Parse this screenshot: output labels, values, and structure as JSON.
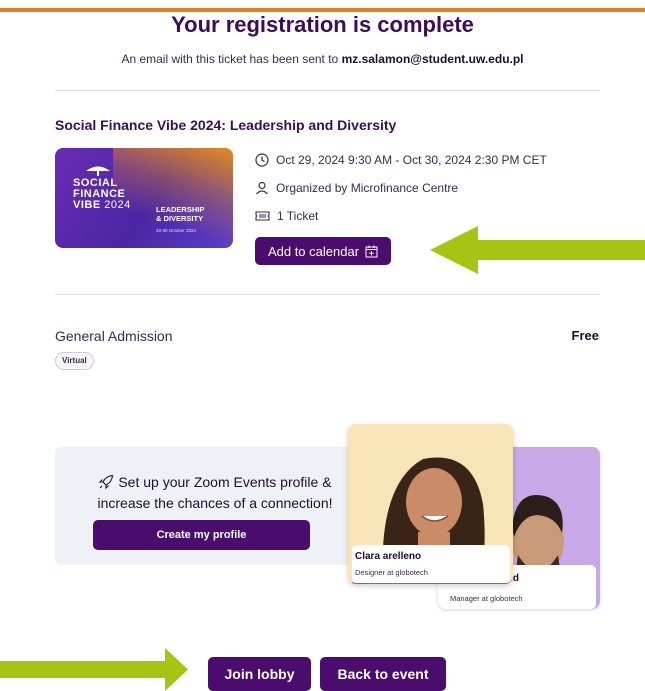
{
  "header": {
    "title": "Your registration is complete",
    "email_prefix": "An email with this ticket has been sent to",
    "email": "mz.salamon@student.uw.edu.pl"
  },
  "event": {
    "name": "Social Finance Vibe 2024: Leadership and Diversity",
    "image_text": {
      "line1": "SOCIAL",
      "line2": "FINANCE",
      "line3_a": "VIBE",
      "line3_b": "2024",
      "lead1": "LEADERSHIP",
      "lead2": "& DIVERSITY",
      "dates": "29-30 October 2024"
    },
    "datetime": "Oct 29, 2024 9:30 AM - Oct 30, 2024 2:30 PM CET",
    "organizer": "Organized by Microfinance Centre",
    "tickets": "1 Ticket",
    "calendar_button": "Add to calendar"
  },
  "ticket": {
    "type": "General Admission",
    "price": "Free",
    "badge": "Virtual"
  },
  "promo": {
    "text": "Set up your Zoom Events profile & increase the chances of a connection!",
    "button": "Create my profile",
    "card1_name": "Clara arelleno",
    "card1_role": "Designer at globotech",
    "card2_name": "old",
    "card2_role": "Manager at globotech"
  },
  "actions": {
    "join": "Join lobby",
    "back": "Back to event"
  },
  "colors": {
    "primary": "#4a0d6e",
    "accent_bar": "#e0821f",
    "arrow": "#a8c412"
  }
}
